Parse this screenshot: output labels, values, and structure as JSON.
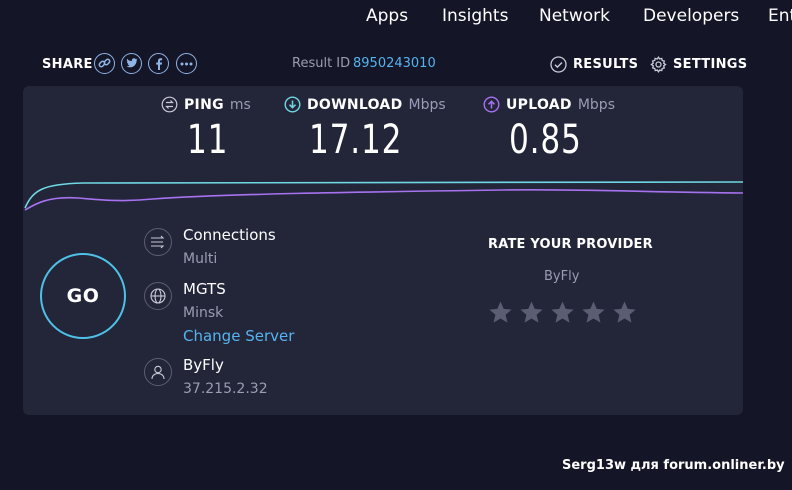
{
  "nav": {
    "items": [
      "Apps",
      "Insights",
      "Network",
      "Developers",
      "Ent"
    ]
  },
  "share": {
    "label": "SHARE",
    "icons": [
      "link-icon",
      "twitter-icon",
      "facebook-icon",
      "more-icon"
    ]
  },
  "result": {
    "label": "Result ID",
    "id": "8950243010"
  },
  "actions": {
    "results_label": "RESULTS",
    "settings_label": "SETTINGS"
  },
  "metrics": {
    "ping": {
      "name": "PING",
      "unit": "ms",
      "value": "11"
    },
    "download": {
      "name": "DOWNLOAD",
      "unit": "Mbps",
      "value": "17.12"
    },
    "upload": {
      "name": "UPLOAD",
      "unit": "Mbps",
      "value": "0.85"
    }
  },
  "go_label": "GO",
  "connections": {
    "title": "Connections",
    "value": "Multi"
  },
  "server": {
    "name": "MGTS",
    "location": "Minsk",
    "change_label": "Change Server"
  },
  "provider": {
    "name": "ByFly",
    "ip": "37.215.2.32"
  },
  "rating": {
    "title": "RATE YOUR PROVIDER",
    "provider": "ByFly",
    "stars_total": 5,
    "stars_selected": 0
  },
  "watermark": "Serg13w для forum.onliner.by",
  "colors": {
    "background": "#141526",
    "panel": "#232539",
    "download_accent": "#6fd8e4",
    "upload_accent": "#a772f0",
    "link": "#55b4f0",
    "go_ring": "#4fc1e6"
  }
}
